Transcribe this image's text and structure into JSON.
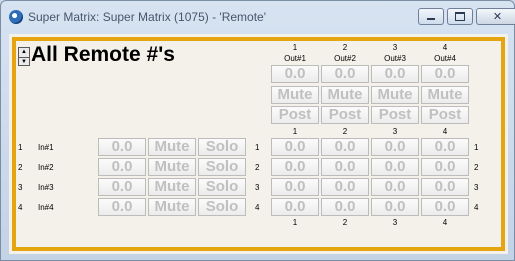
{
  "window": {
    "title": "Super Matrix: Super Matrix (1075) - 'Remote'",
    "minimize_glyph": "minimize-icon",
    "maximize_glyph": "maximize-icon",
    "close_glyph": "✕"
  },
  "heading": "All Remote #'s",
  "spinner": {
    "up": "▲",
    "down": "▼"
  },
  "outputs": [
    {
      "number": "1",
      "name": "Out#1",
      "level": "0.0",
      "mute": "Mute",
      "post": "Post"
    },
    {
      "number": "2",
      "name": "Out#2",
      "level": "0.0",
      "mute": "Mute",
      "post": "Post"
    },
    {
      "number": "3",
      "name": "Out#3",
      "level": "0.0",
      "mute": "Mute",
      "post": "Post"
    },
    {
      "number": "4",
      "name": "Out#4",
      "level": "0.0",
      "mute": "Mute",
      "post": "Post"
    }
  ],
  "inputs": [
    {
      "number": "1",
      "name": "In#1",
      "level": "0.0",
      "mute": "Mute",
      "solo": "Solo",
      "crosspoints": [
        "0.0",
        "0.0",
        "0.0",
        "0.0"
      ]
    },
    {
      "number": "2",
      "name": "In#2",
      "level": "0.0",
      "mute": "Mute",
      "solo": "Solo",
      "crosspoints": [
        "0.0",
        "0.0",
        "0.0",
        "0.0"
      ]
    },
    {
      "number": "3",
      "name": "In#3",
      "level": "0.0",
      "mute": "Mute",
      "solo": "Solo",
      "crosspoints": [
        "0.0",
        "0.0",
        "0.0",
        "0.0"
      ]
    },
    {
      "number": "4",
      "name": "In#4",
      "level": "0.0",
      "mute": "Mute",
      "solo": "Solo",
      "crosspoints": [
        "0.0",
        "0.0",
        "0.0",
        "0.0"
      ]
    }
  ],
  "colors": {
    "frame": "#e5a511",
    "button_text": "#c0c0c0",
    "panel": "#f4f1ea"
  }
}
